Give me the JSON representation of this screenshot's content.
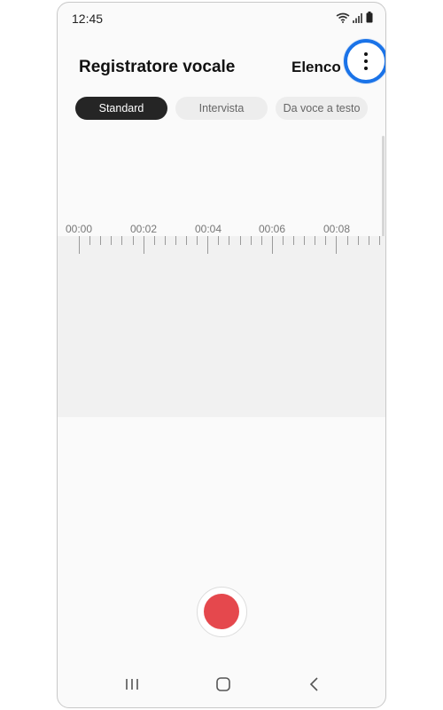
{
  "status_bar": {
    "time": "12:45",
    "icons": [
      "wifi-icon",
      "signal-icon",
      "battery-icon"
    ]
  },
  "header": {
    "title": "Registratore vocale",
    "list_label": "Elenco",
    "more_icon": "more-options-icon",
    "highlight_color": "#1a73e8"
  },
  "modes": [
    {
      "label": "Standard",
      "selected": true
    },
    {
      "label": "Intervista",
      "selected": false
    },
    {
      "label": "Da voce a testo",
      "selected": false
    }
  ],
  "timeline": {
    "labels": [
      "00:00",
      "00:02",
      "00:04",
      "00:06",
      "00:08"
    ]
  },
  "record": {
    "icon": "record-icon",
    "color": "#e5484d"
  },
  "nav_bar": {
    "icons": [
      "recent-apps-icon",
      "home-icon",
      "back-icon"
    ]
  }
}
